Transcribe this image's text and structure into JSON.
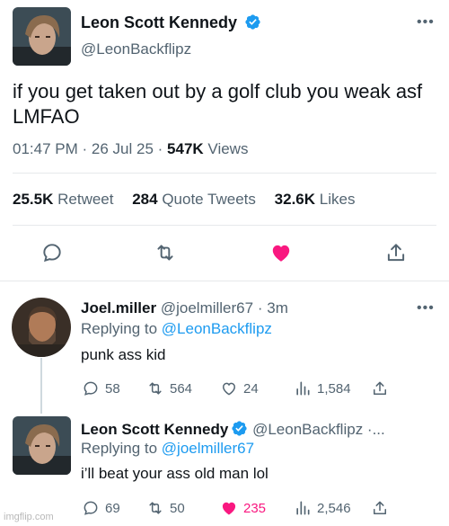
{
  "main_tweet": {
    "author_name": "Leon Scott Kennedy",
    "author_handle": "@LeonBackflipz",
    "text": "if you get taken out by a golf club you weak asf LMFAO",
    "time": "01:47 PM",
    "date": "26 Jul 25",
    "views_count": "547K",
    "views_label": "Views",
    "retweets_count": "25.5K",
    "retweets_label": "Retweet",
    "quotes_count": "284",
    "quotes_label": "Quote Tweets",
    "likes_count": "32.6K",
    "likes_label": "Likes",
    "liked": true
  },
  "replies": [
    {
      "author_name": "Joel.miller",
      "author_handle": "@joelmiller67",
      "time_ago": "3m",
      "replying_label": "Replying to",
      "replying_to": "@LeonBackflipz",
      "text": "punk ass kid",
      "reply_count": "58",
      "retweet_count": "564",
      "like_count": "24",
      "view_count": "1,584",
      "liked": false
    },
    {
      "author_name": "Leon Scott Kennedy",
      "author_handle": "@LeonBackflipz ·...",
      "replying_label": "Replying to",
      "replying_to": "@joelmiller67",
      "text": "i’ll beat your ass old man lol",
      "reply_count": "69",
      "retweet_count": "50",
      "like_count": "235",
      "view_count": "2,546",
      "liked": true
    }
  ],
  "watermark": "imgflip.com",
  "colors": {
    "accent": "#1d9bf0",
    "like": "#f91880",
    "secondary_text": "#536471",
    "verified": "#1d9bf0"
  },
  "icons": [
    "verified-icon",
    "more-icon",
    "reply-icon",
    "retweet-icon",
    "heart-icon",
    "share-icon",
    "views-icon"
  ]
}
